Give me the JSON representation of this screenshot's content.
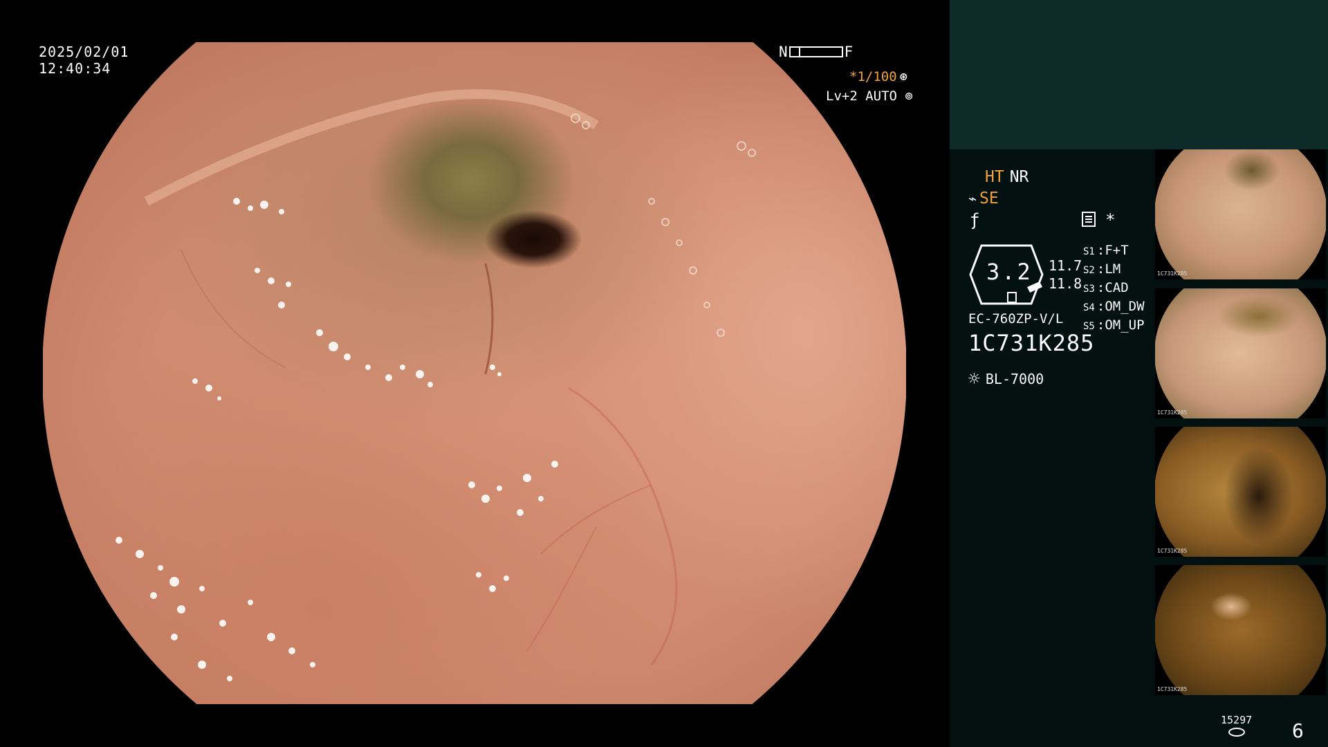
{
  "datetime": {
    "date": "2025/02/01",
    "time": "12:40:34"
  },
  "focus": {
    "near": "N",
    "far": "F"
  },
  "shutter": {
    "value": "*1/100",
    "icon": "shutter-icon"
  },
  "level": {
    "value": "Lv+2 AUTO",
    "icon": "iris-icon"
  },
  "modes": {
    "ht": "HT",
    "nr": "NR",
    "se": "SE"
  },
  "icons": {
    "se": "se-icon",
    "freeze": "freeze-icon",
    "report": "report-icon",
    "star": "star-icon",
    "light": "light-source-icon",
    "disk": "disk-icon"
  },
  "gauge": {
    "value": "3.2",
    "reading1": "11.7",
    "reading2": "11.8"
  },
  "switches": [
    {
      "key": "S1",
      "value": "F+T"
    },
    {
      "key": "S2",
      "value": "LM"
    },
    {
      "key": "S3",
      "value": "CAD"
    },
    {
      "key": "S4",
      "value": "OM_DW"
    },
    {
      "key": "S5",
      "value": "OM_UP"
    }
  ],
  "scope": {
    "model": "EC-760ZP-V/L",
    "serial": "1C731K285",
    "light_source": "BL-7000"
  },
  "thumbnails": [
    {
      "serial": "1C731K285"
    },
    {
      "serial": "1C731K285"
    },
    {
      "serial": "1C731K285"
    },
    {
      "serial": "1C731K285"
    }
  ],
  "storage": {
    "count": "15297",
    "page": "6"
  },
  "colors": {
    "accent": "#f2a23a",
    "panel": "#02100f",
    "panel_top": "#0d2a28"
  }
}
